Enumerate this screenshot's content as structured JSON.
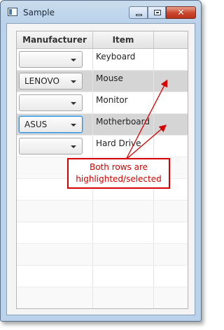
{
  "window": {
    "title": "Sample",
    "controls": [
      "minimize",
      "maximize",
      "close"
    ]
  },
  "table": {
    "columns": [
      "Manufacturer",
      "Item",
      ""
    ],
    "rows": [
      {
        "manufacturer": "",
        "item": "Keyboard",
        "selected": false
      },
      {
        "manufacturer": "LENOVO",
        "item": "Mouse",
        "selected": true
      },
      {
        "manufacturer": "",
        "item": "Monitor",
        "selected": false
      },
      {
        "manufacturer": "ASUS",
        "item": "Motherboard",
        "selected": true,
        "focused": true
      },
      {
        "manufacturer": "",
        "item": "Hard Drive",
        "selected": false
      }
    ],
    "empty_row_count": 7
  },
  "annotation": {
    "text_line1": "Both rows are",
    "text_line2": "highlighted/selected",
    "color": "#d60000"
  }
}
